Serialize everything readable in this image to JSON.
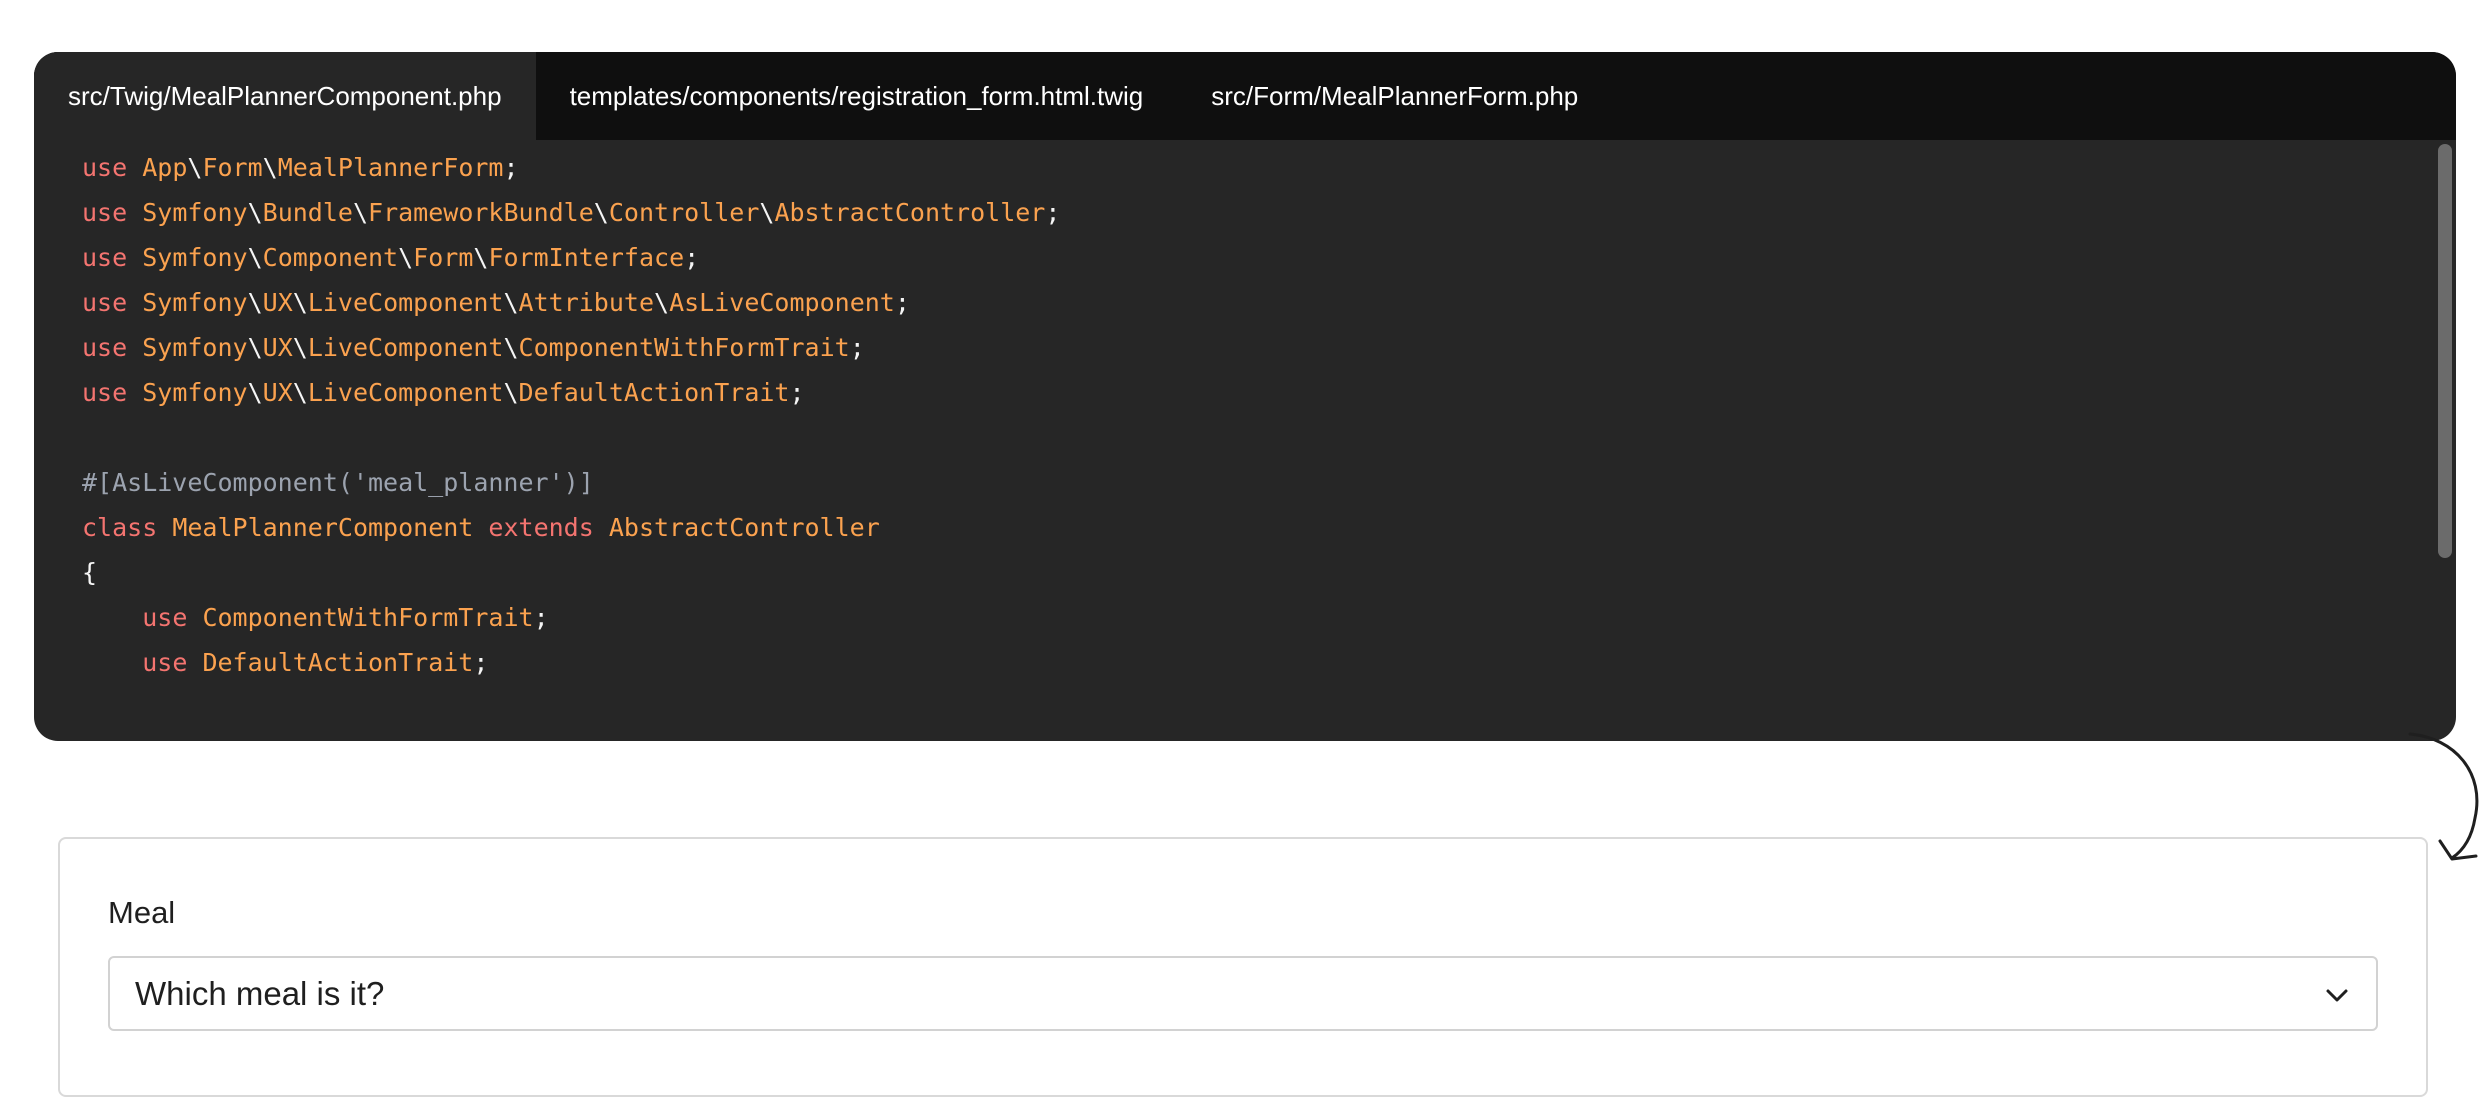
{
  "tabs": [
    {
      "label": "src/Twig/MealPlannerComponent.php",
      "active": true
    },
    {
      "label": "templates/components/registration_form.html.twig",
      "active": false
    },
    {
      "label": "src/Form/MealPlannerForm.php",
      "active": false
    }
  ],
  "code_lines": [
    [
      [
        "kw",
        "use"
      ],
      [
        "punc",
        " "
      ],
      [
        "cls",
        "App"
      ],
      [
        "punc",
        "\\"
      ],
      [
        "cls",
        "Form"
      ],
      [
        "punc",
        "\\"
      ],
      [
        "cls",
        "MealPlannerForm"
      ],
      [
        "punc",
        ";"
      ]
    ],
    [
      [
        "kw",
        "use"
      ],
      [
        "punc",
        " "
      ],
      [
        "cls",
        "Symfony"
      ],
      [
        "punc",
        "\\"
      ],
      [
        "cls",
        "Bundle"
      ],
      [
        "punc",
        "\\"
      ],
      [
        "cls",
        "FrameworkBundle"
      ],
      [
        "punc",
        "\\"
      ],
      [
        "cls",
        "Controller"
      ],
      [
        "punc",
        "\\"
      ],
      [
        "cls",
        "AbstractController"
      ],
      [
        "punc",
        ";"
      ]
    ],
    [
      [
        "kw",
        "use"
      ],
      [
        "punc",
        " "
      ],
      [
        "cls",
        "Symfony"
      ],
      [
        "punc",
        "\\"
      ],
      [
        "cls",
        "Component"
      ],
      [
        "punc",
        "\\"
      ],
      [
        "cls",
        "Form"
      ],
      [
        "punc",
        "\\"
      ],
      [
        "cls",
        "FormInterface"
      ],
      [
        "punc",
        ";"
      ]
    ],
    [
      [
        "kw",
        "use"
      ],
      [
        "punc",
        " "
      ],
      [
        "cls",
        "Symfony"
      ],
      [
        "punc",
        "\\"
      ],
      [
        "cls",
        "UX"
      ],
      [
        "punc",
        "\\"
      ],
      [
        "cls",
        "LiveComponent"
      ],
      [
        "punc",
        "\\"
      ],
      [
        "cls",
        "Attribute"
      ],
      [
        "punc",
        "\\"
      ],
      [
        "cls",
        "AsLiveComponent"
      ],
      [
        "punc",
        ";"
      ]
    ],
    [
      [
        "kw",
        "use"
      ],
      [
        "punc",
        " "
      ],
      [
        "cls",
        "Symfony"
      ],
      [
        "punc",
        "\\"
      ],
      [
        "cls",
        "UX"
      ],
      [
        "punc",
        "\\"
      ],
      [
        "cls",
        "LiveComponent"
      ],
      [
        "punc",
        "\\"
      ],
      [
        "cls",
        "ComponentWithFormTrait"
      ],
      [
        "punc",
        ";"
      ]
    ],
    [
      [
        "kw",
        "use"
      ],
      [
        "punc",
        " "
      ],
      [
        "cls",
        "Symfony"
      ],
      [
        "punc",
        "\\"
      ],
      [
        "cls",
        "UX"
      ],
      [
        "punc",
        "\\"
      ],
      [
        "cls",
        "LiveComponent"
      ],
      [
        "punc",
        "\\"
      ],
      [
        "cls",
        "DefaultActionTrait"
      ],
      [
        "punc",
        ";"
      ]
    ],
    [],
    [
      [
        "attr",
        "#[AsLiveComponent('meal_planner')]"
      ]
    ],
    [
      [
        "kw",
        "class"
      ],
      [
        "punc",
        " "
      ],
      [
        "cls",
        "MealPlannerComponent"
      ],
      [
        "punc",
        " "
      ],
      [
        "kw",
        "extends"
      ],
      [
        "punc",
        " "
      ],
      [
        "cls",
        "AbstractController"
      ]
    ],
    [
      [
        "punc",
        "{"
      ]
    ],
    [
      [
        "punc",
        "    "
      ],
      [
        "kw",
        "use"
      ],
      [
        "punc",
        " "
      ],
      [
        "cls",
        "ComponentWithFormTrait"
      ],
      [
        "punc",
        ";"
      ]
    ],
    [
      [
        "punc",
        "    "
      ],
      [
        "kw",
        "use"
      ],
      [
        "punc",
        " "
      ],
      [
        "cls",
        "DefaultActionTrait"
      ],
      [
        "punc",
        ";"
      ]
    ]
  ],
  "form": {
    "meal_label": "Meal",
    "meal_select_value": "Which meal is it?"
  },
  "icons": {
    "arrow": "curved-arrow-icon",
    "chevron": "chevron-down-icon"
  },
  "colors": {
    "code_bg": "#262626",
    "tabbar_bg": "#0f0f0f",
    "keyword": "#f47470",
    "class_name": "#fba24f",
    "attribute": "#9ca3af"
  }
}
